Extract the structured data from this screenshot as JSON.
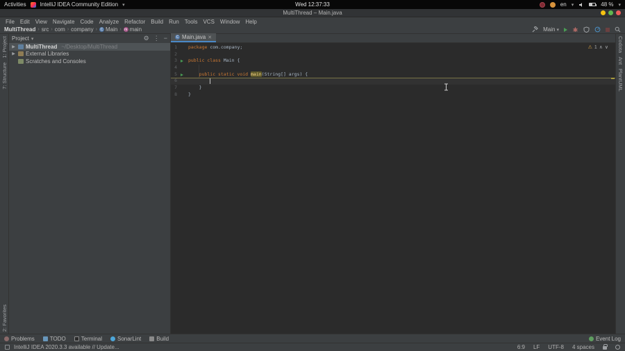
{
  "icons": {
    "chevron_down": "▾",
    "chevron_right": "›",
    "tree_chevron": "▶",
    "gear": "⚙",
    "minus": "−",
    "ellipsis": "⋮",
    "warning": "⚠",
    "chevron_up_small": "∧",
    "chevron_down_small": "∨",
    "close": "✕",
    "class_badge": "C",
    "method_badge": "m"
  },
  "gnome_bar": {
    "activities_label": "Activities",
    "app_menu_label": "IntelliJ IDEA Community Edition",
    "clock": "Wed 12:37:33",
    "keyboard_layout": "en",
    "battery_percent": "48 %"
  },
  "window": {
    "title": "MultiThread – Main.java"
  },
  "menu_bar": [
    "File",
    "Edit",
    "View",
    "Navigate",
    "Code",
    "Analyze",
    "Refactor",
    "Build",
    "Run",
    "Tools",
    "VCS",
    "Window",
    "Help"
  ],
  "nav_bar": {
    "breadcrumbs": [
      {
        "label": "MultiThread",
        "bold": true
      },
      {
        "label": "src"
      },
      {
        "label": "com"
      },
      {
        "label": "company"
      },
      {
        "label": "Main",
        "icon": "class"
      },
      {
        "label": "main",
        "icon": "method"
      }
    ],
    "run_config": "Main"
  },
  "left_stripe": {
    "top": [
      "1: Project",
      "7: Structure"
    ],
    "bottom": [
      "2: Favorites"
    ]
  },
  "right_stripe": {
    "top": [
      "Codota",
      "Ant",
      "PlantUML"
    ]
  },
  "project_panel": {
    "title": "Project",
    "tree": [
      {
        "label": "MultiThread",
        "path": "~/Desktop/MultiThread",
        "icon": "folder",
        "chevron": true,
        "selected": true,
        "bold": true
      },
      {
        "label": "External Libraries",
        "icon": "library",
        "chevron": true
      },
      {
        "label": "Scratches and Consoles",
        "icon": "scratch",
        "chevron": false
      }
    ]
  },
  "editor": {
    "tab": {
      "title": "Main.java"
    },
    "inspections": {
      "warnings": "1"
    },
    "code": [
      {
        "n": "1",
        "tokens": [
          {
            "t": "package ",
            "c": "kw"
          },
          {
            "t": "com.company;",
            "c": "pl"
          }
        ]
      },
      {
        "n": "2",
        "tokens": []
      },
      {
        "n": "3",
        "run": true,
        "tokens": [
          {
            "t": "public class ",
            "c": "kw"
          },
          {
            "t": "Main {",
            "c": "pl"
          }
        ]
      },
      {
        "n": "4",
        "tokens": []
      },
      {
        "n": "5",
        "run": true,
        "tokens": [
          {
            "t": "    ",
            "c": "pl"
          },
          {
            "t": "public static void ",
            "c": "kw"
          },
          {
            "t": "main",
            "c": "mh"
          },
          {
            "t": "(String[] args) {",
            "c": "pl"
          }
        ]
      },
      {
        "n": "6",
        "caret": true,
        "tokens": []
      },
      {
        "n": "7",
        "tokens": [
          {
            "t": "    }",
            "c": "pl"
          }
        ]
      },
      {
        "n": "8",
        "tokens": [
          {
            "t": "}",
            "c": "pl"
          }
        ]
      }
    ]
  },
  "bottom_bar": {
    "left": [
      "Problems",
      "TODO",
      "Terminal",
      "SonarLint",
      "Build"
    ],
    "right": [
      "Event Log"
    ]
  },
  "status_bar": {
    "message": "IntelliJ IDEA 2020.3.3 available // Update...",
    "caret_position": "6:9",
    "line_ending": "LF",
    "encoding": "UTF-8",
    "indent": "4 spaces"
  }
}
